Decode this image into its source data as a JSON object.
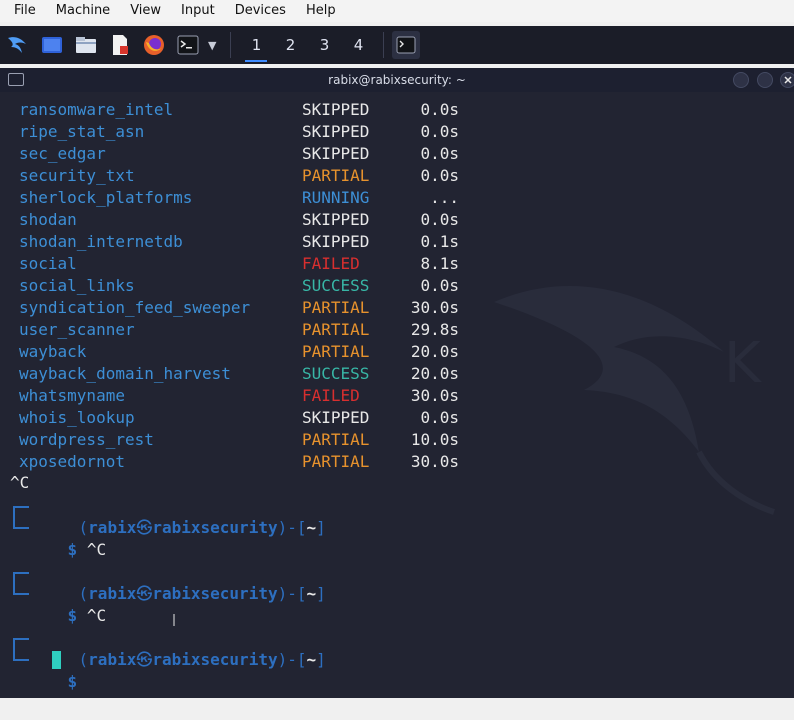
{
  "host_menu": [
    "File",
    "Machine",
    "View",
    "Input",
    "Devices",
    "Help"
  ],
  "panel": {
    "workspaces": [
      "1",
      "2",
      "3",
      "4"
    ],
    "active_workspace": "1"
  },
  "terminal": {
    "title": "rabix@rabixsecurity: ~",
    "rows": [
      {
        "module": "ransomware_intel",
        "status": "SKIPPED",
        "time": "0.0s"
      },
      {
        "module": "ripe_stat_asn",
        "status": "SKIPPED",
        "time": "0.0s"
      },
      {
        "module": "sec_edgar",
        "status": "SKIPPED",
        "time": "0.0s"
      },
      {
        "module": "security_txt",
        "status": "PARTIAL",
        "time": "0.0s"
      },
      {
        "module": "sherlock_platforms",
        "status": "RUNNING",
        "time": "..."
      },
      {
        "module": "shodan",
        "status": "SKIPPED",
        "time": "0.0s"
      },
      {
        "module": "shodan_internetdb",
        "status": "SKIPPED",
        "time": "0.1s"
      },
      {
        "module": "social",
        "status": "FAILED",
        "time": "8.1s"
      },
      {
        "module": "social_links",
        "status": "SUCCESS",
        "time": "0.0s"
      },
      {
        "module": "syndication_feed_sweeper",
        "status": "PARTIAL",
        "time": "30.0s"
      },
      {
        "module": "user_scanner",
        "status": "PARTIAL",
        "time": "29.8s"
      },
      {
        "module": "wayback",
        "status": "PARTIAL",
        "time": "20.0s"
      },
      {
        "module": "wayback_domain_harvest",
        "status": "SUCCESS",
        "time": "20.0s"
      },
      {
        "module": "whatsmyname",
        "status": "FAILED",
        "time": "30.0s"
      },
      {
        "module": "whois_lookup",
        "status": "SKIPPED",
        "time": "0.0s"
      },
      {
        "module": "wordpress_rest",
        "status": "PARTIAL",
        "time": "10.0s"
      },
      {
        "module": "xposedornot",
        "status": "PARTIAL",
        "time": "30.0s"
      }
    ],
    "interrupt": "^C",
    "prompt": {
      "user": "rabix",
      "at_symbol": "㉿",
      "host": "rabixsecurity",
      "dir": "~",
      "dollar": "$"
    },
    "prompts": [
      {
        "cmd": "^C"
      },
      {
        "cmd": "^C"
      },
      {
        "cmd": ""
      }
    ]
  },
  "colors": {
    "terminal_bg": "#222432",
    "module": "#3d8fd6",
    "skipped": "#e8e8e8",
    "partial": "#e7922d",
    "running": "#3d8fd6",
    "failed": "#d82f2f",
    "success": "#38b6a6",
    "prompt": "#2d6fc0",
    "cursor": "#2fcfc0"
  }
}
